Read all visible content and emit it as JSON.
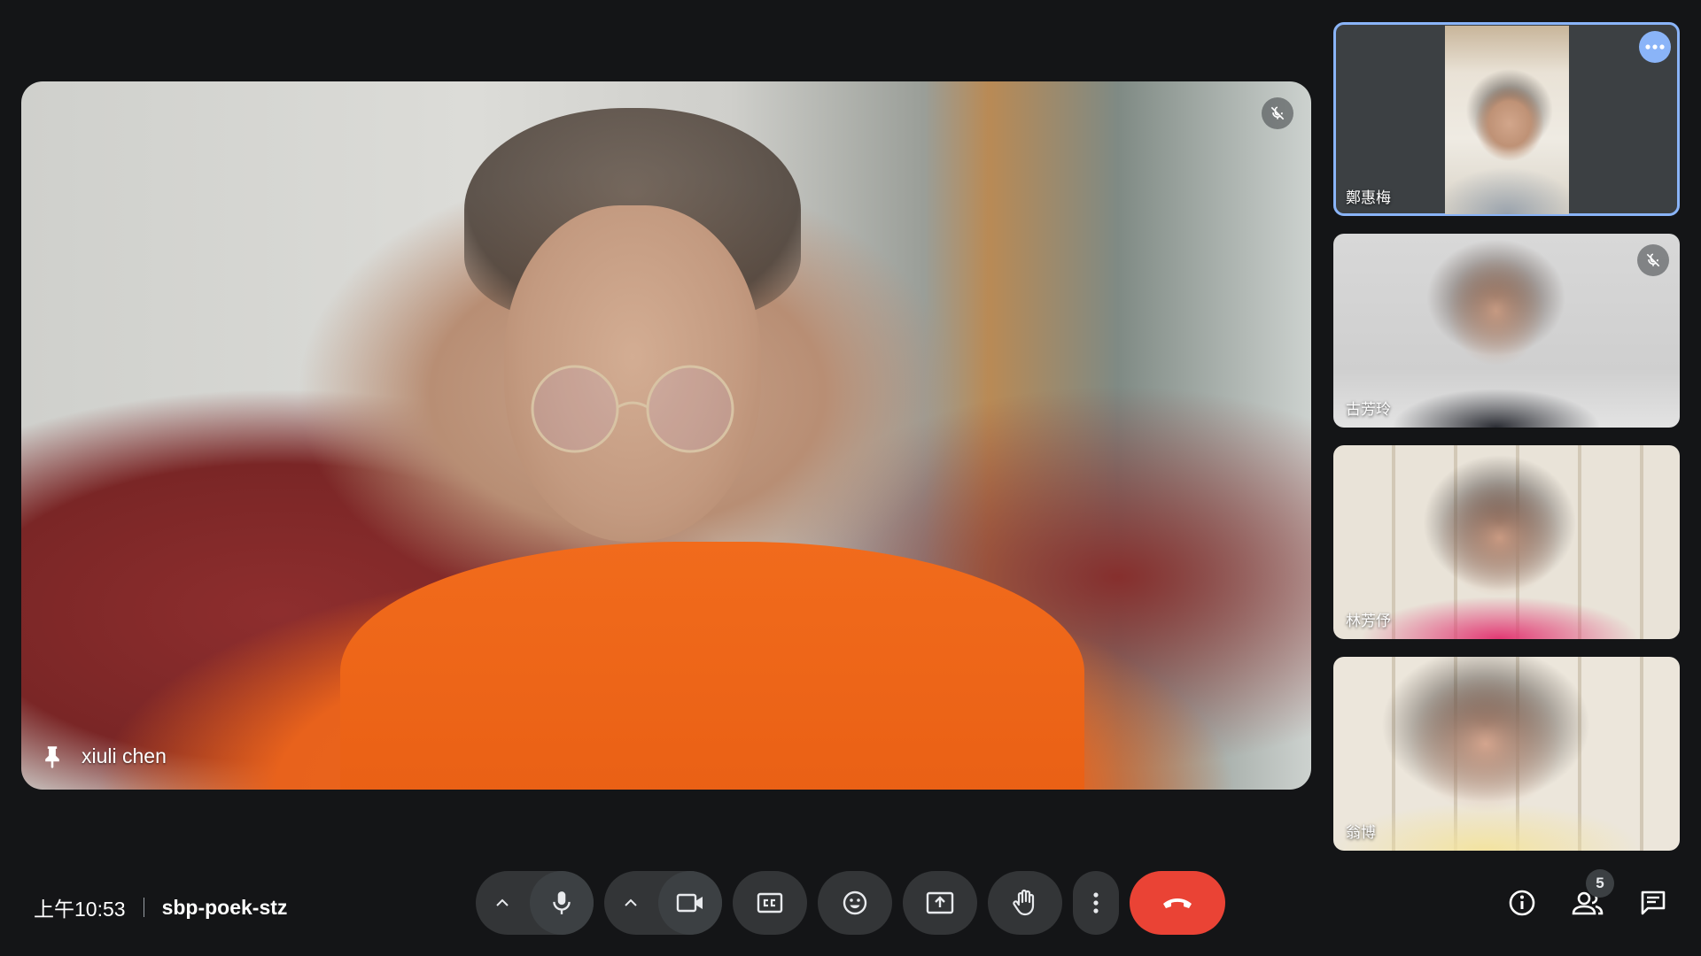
{
  "main_participant": {
    "name": "xiuli chen",
    "pinned": true,
    "muted": true
  },
  "participants": [
    {
      "name": "鄭惠梅",
      "active_speaker": true
    },
    {
      "name": "古芳玲",
      "muted": true
    },
    {
      "name": "林芳伃"
    },
    {
      "name": "翁博"
    }
  ],
  "meeting": {
    "time": "上午10:53",
    "code": "sbp-poek-stz"
  },
  "controls": {
    "mic_icon": "microphone-icon",
    "camera_icon": "video-camera-icon",
    "captions_icon": "closed-captions-icon",
    "reactions_icon": "emoji-icon",
    "present_icon": "present-screen-icon",
    "raise_hand_icon": "hand-icon",
    "more_icon": "more-vert-icon",
    "end_call_icon": "phone-hangup-icon"
  },
  "side_panel": {
    "people_count": "5"
  },
  "colors": {
    "background": "#141517",
    "button": "#333537",
    "end_call": "#ea4335",
    "active_outline": "#8ab4f8"
  }
}
